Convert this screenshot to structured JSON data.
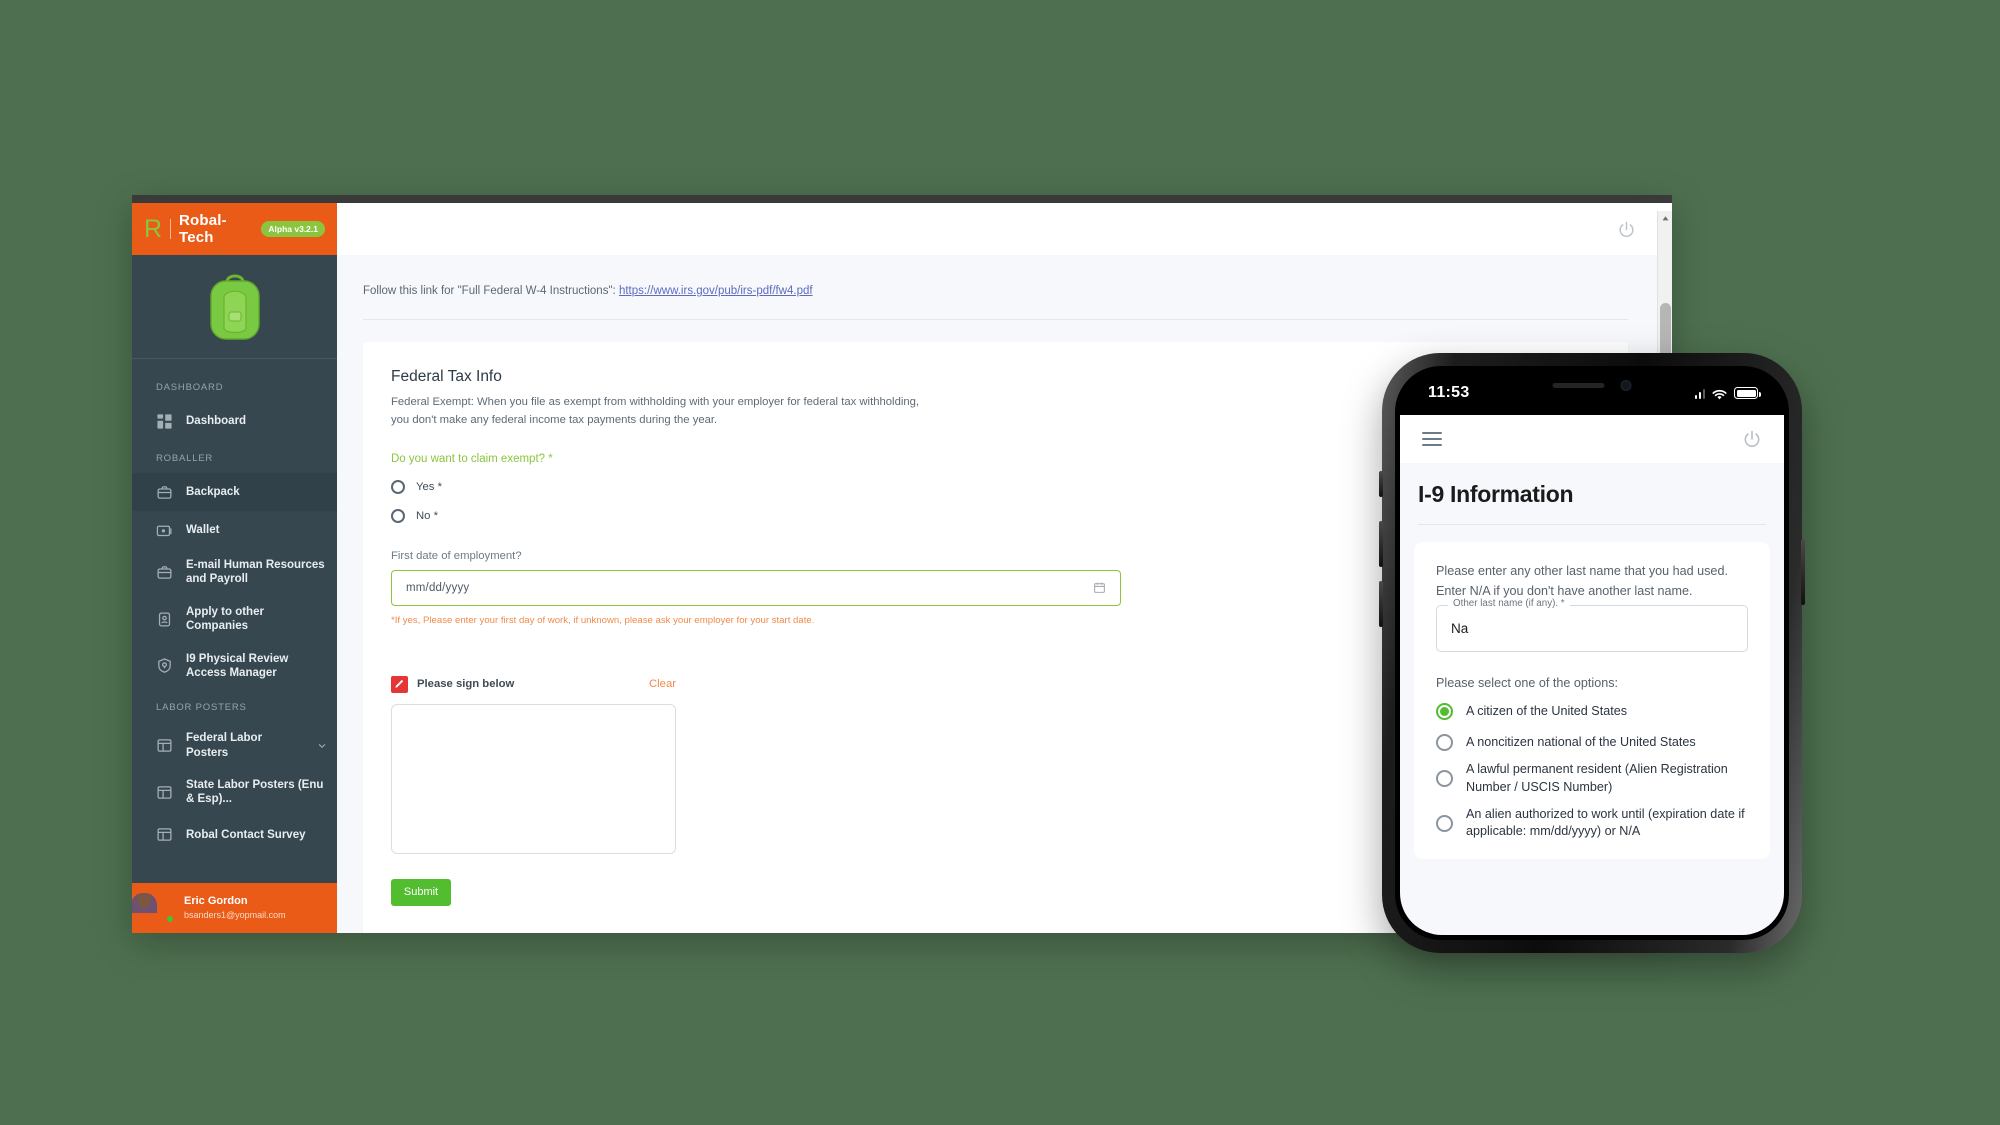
{
  "desktop": {
    "brand": {
      "logo_letter": "R",
      "name": "Robal-Tech",
      "version_badge": "Alpha v3.2.1"
    },
    "sidebar": {
      "sections": [
        {
          "label": "DASHBOARD"
        },
        {
          "label": "ROBALLER"
        },
        {
          "label": "LABOR POSTERS"
        }
      ],
      "items": [
        {
          "label": "Dashboard",
          "icon": "grid-icon",
          "active": false
        },
        {
          "label": "Backpack",
          "icon": "briefcase-icon",
          "active": true
        },
        {
          "label": "Wallet",
          "icon": "wallet-icon",
          "active": false
        },
        {
          "label": "E-mail Human Resources and Payroll",
          "icon": "briefcase-icon",
          "active": false
        },
        {
          "label": "Apply to other Companies",
          "icon": "id-badge-icon",
          "active": false
        },
        {
          "label": "I9 Physical Review Access Manager",
          "icon": "shield-check-icon",
          "active": false
        },
        {
          "label": "Federal Labor Posters",
          "icon": "layout-icon",
          "active": false,
          "expandable": true
        },
        {
          "label": "State Labor Posters (Enu & Esp)...",
          "icon": "layout-icon",
          "active": false
        },
        {
          "label": "Robal Contact Survey",
          "icon": "layout-icon",
          "active": false
        }
      ],
      "user": {
        "name": "Eric Gordon",
        "email": "bsanders1@yopmail.com",
        "status": "online"
      }
    },
    "topbar": {
      "power_icon": "power-icon"
    },
    "content": {
      "instructions_prefix": "Follow this link for \"Full Federal W-4 Instructions\":",
      "instructions_link": "https://www.irs.gov/pub/irs-pdf/fw4.pdf",
      "card": {
        "title": "Federal Tax Info",
        "description_line1": "Federal Exempt: When you file as exempt from withholding with your employer for federal tax withholding,",
        "description_line2": "you don't make any federal income tax payments during the year.",
        "claim_question": "Do you want to claim exempt? *",
        "options": [
          {
            "label": "Yes *",
            "selected": false
          },
          {
            "label": "No *",
            "selected": false
          }
        ],
        "date_label": "First date of employment?",
        "date_placeholder": "mm/dd/yyyy",
        "date_value": "",
        "date_hint": "*If yes, Please enter your first day of work, if unknown, please ask your employer for your start date.",
        "signature_label": "Please sign below",
        "clear_label": "Clear",
        "submit_label": "Submit"
      }
    }
  },
  "phone": {
    "status": {
      "time": "11:53"
    },
    "appbar": {
      "menu_icon": "hamburger-icon",
      "power_icon": "power-icon"
    },
    "title": "I-9 Information",
    "form": {
      "question1": "Please enter any other last name that you had used. Enter N/A if you don't have another last name.",
      "field_label": "Other last name (if any). *",
      "field_value": "Na",
      "question2": "Please select one of the options:",
      "options": [
        {
          "label": "A citizen of the United States",
          "selected": true
        },
        {
          "label": "A noncitizen national of the United States",
          "selected": false
        },
        {
          "label": "A lawful permanent resident (Alien Registration Number / USCIS Number)",
          "selected": false
        },
        {
          "label": "An alien authorized to work until (expiration date if applicable: mm/dd/yyyy) or N/A",
          "selected": false
        }
      ]
    }
  },
  "colors": {
    "brand_orange": "#ea5b18",
    "brand_green": "#8bc53f",
    "sidebar_dark": "#37474f",
    "background_green": "#4e7050",
    "submit_green": "#52bd2e",
    "hint_orange": "#f08b4a"
  }
}
